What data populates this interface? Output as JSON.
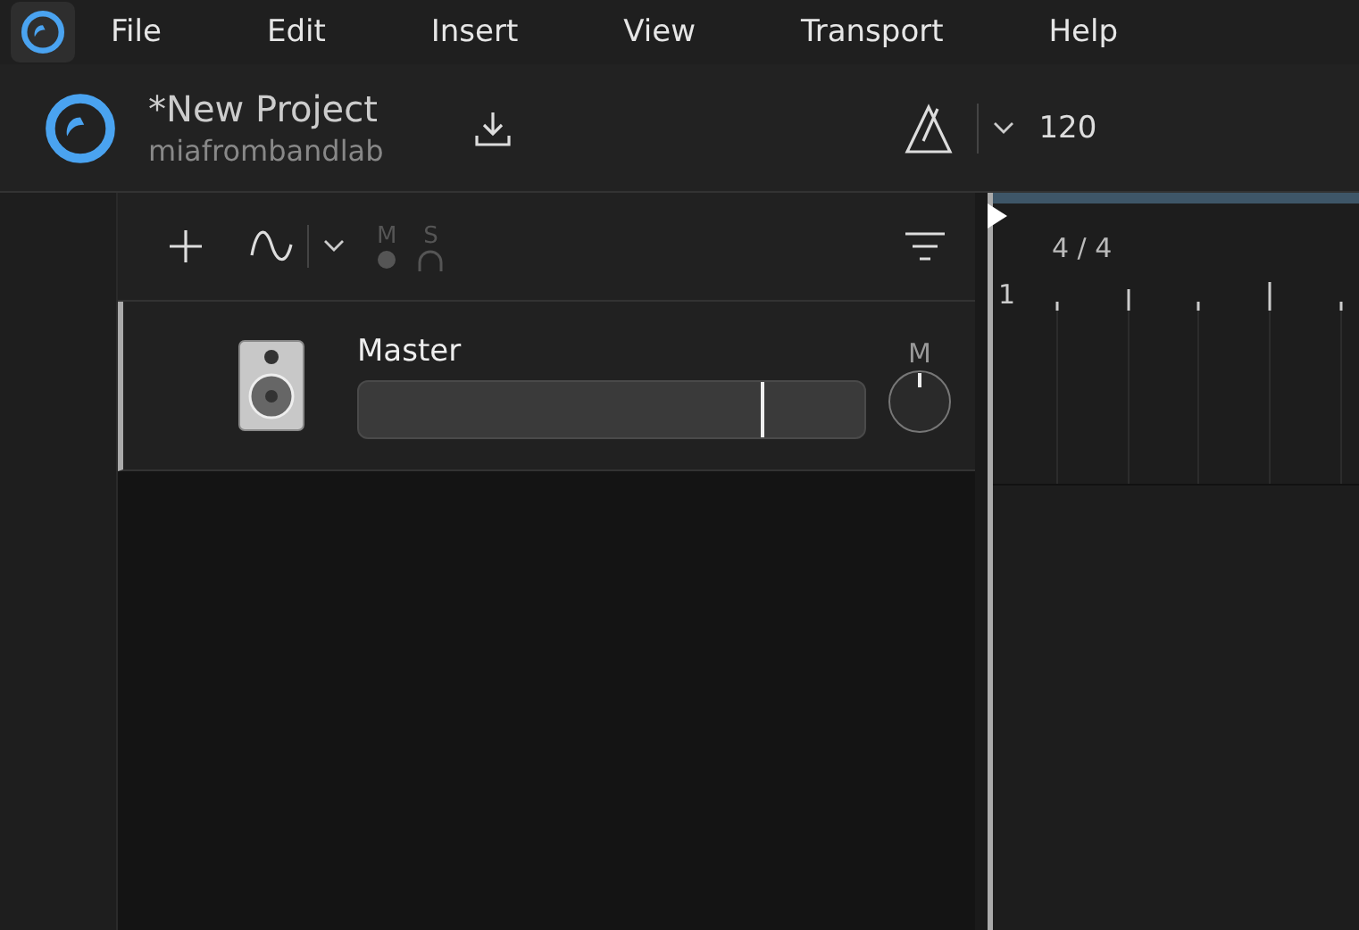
{
  "menu_bar": {
    "items": [
      "File",
      "Edit",
      "Insert",
      "View",
      "Transport",
      "Help"
    ]
  },
  "project": {
    "title": "*New Project",
    "owner": "miafrombandlab"
  },
  "transport": {
    "tempo": "120"
  },
  "track_toolbar": {
    "mute_label": "M",
    "solo_label": "S",
    "disabled": true
  },
  "tracks": [
    {
      "name": "Master",
      "selected": true,
      "level": 0.8,
      "mute_label": "M"
    }
  ],
  "timeline": {
    "time_signature": "4 / 4",
    "bar_label": "1"
  }
}
